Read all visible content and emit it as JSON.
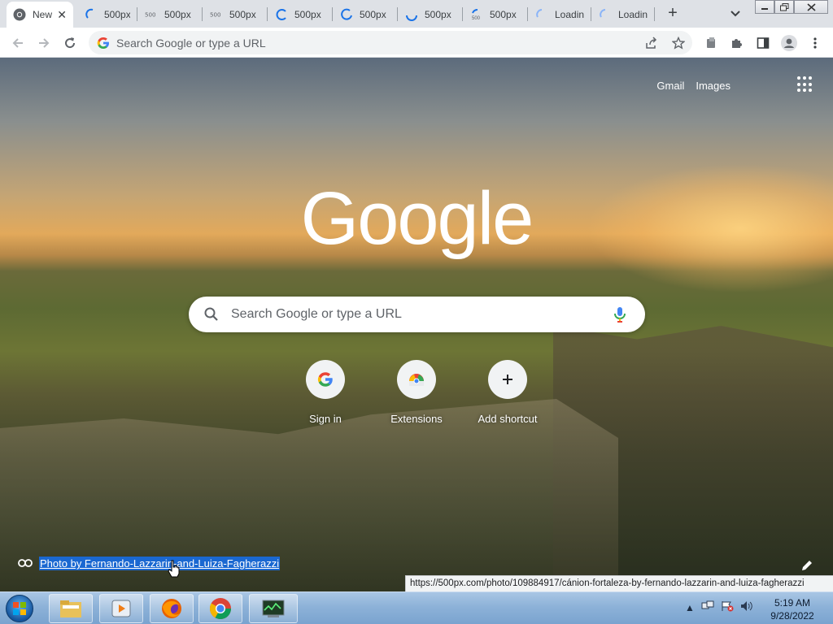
{
  "tabs": [
    {
      "title": "New Tab",
      "active": true
    },
    {
      "title": "500px"
    },
    {
      "title": "500px"
    },
    {
      "title": "500px"
    },
    {
      "title": "500px"
    },
    {
      "title": "500px"
    },
    {
      "title": "500px"
    },
    {
      "title": "500px"
    },
    {
      "title": "Loading..."
    },
    {
      "title": "Loading..."
    }
  ],
  "toolbar": {
    "omnibox_placeholder": "Search Google or type a URL"
  },
  "ntp": {
    "gmail": "Gmail",
    "images": "Images",
    "logo": "Google",
    "search_placeholder": "Search Google or type a URL",
    "shortcuts": [
      {
        "label": "Sign in",
        "icon": "google-g-icon"
      },
      {
        "label": "Extensions",
        "icon": "chrome-web-store-icon"
      },
      {
        "label": "Add shortcut",
        "icon": "plus-icon"
      }
    ],
    "attribution": "Photo by Fernando-Lazzarin-and-Luiza-Fagherazzi",
    "status_url": "https://500px.com/photo/109884917/cánion-fortaleza-by-fernando-lazzarin-and-luiza-fagherazzi"
  },
  "taskbar": {
    "time": "5:19 AM",
    "date": "9/28/2022"
  },
  "colors": {
    "selection": "#1a68d1",
    "tabstrip": "#dee1e6",
    "omnibox": "#f1f3f4"
  }
}
